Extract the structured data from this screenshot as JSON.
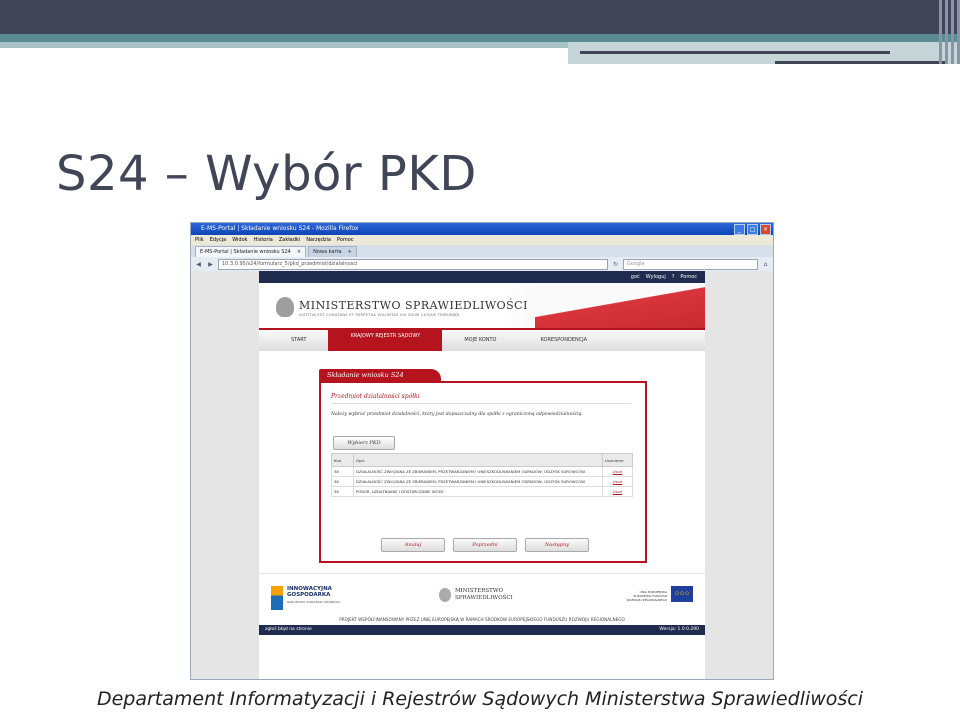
{
  "slide": {
    "title": "S24 – Wybór PKD",
    "footer": "Departament Informatyzacji i Rejestrów Sądowych Ministerstwa Sprawiedliwości"
  },
  "browser": {
    "window_title": "E-MS-Portal | Składanie wniosku S24 - Mozilla Firefox",
    "menu": [
      "Plik",
      "Edycja",
      "Widok",
      "Historia",
      "Zakładki",
      "Narzędzia",
      "Pomoc"
    ],
    "tabs": [
      {
        "label": "E-MS-Portal | Składanie wniosku S24",
        "close": "×"
      },
      {
        "label": "Nowa karta",
        "close": "+"
      }
    ],
    "url": "10.3.0.95/s24/formularz_5/pkd_przedmiot/dzialalnosci",
    "search_placeholder": "Google"
  },
  "portal": {
    "top_links": [
      "goć",
      "Wyloguj",
      "?",
      "Pomoc"
    ],
    "logo_title": "MINISTERSTWO SPRAWIEDLIWOŚCI",
    "logo_motto": "IUSTITIA EST CONSTANS ET PERPETUA VOLUNTAS IUS SUUM CUIQUE TRIBUENDI",
    "nav": [
      "START",
      "KRAJOWY REJESTR SĄDOWY",
      "MOJE KONTO",
      "KORESPONDENCJA"
    ],
    "panel_title": "Składanie wniosku S24",
    "section_title": "Przedmiot działalności spółki",
    "instruction": "Należy wybrać przedmiot działalności, który jest dopuszczalny dla spółki z ograniczoną odpowiedzialnością.",
    "pick_button": "Wybierz PKD",
    "table": {
      "headers": [
        "Kod",
        "Opis",
        "Usunięcie"
      ],
      "rows": [
        {
          "code": "38",
          "desc": "DZIAŁALNOŚĆ ZWIĄZANA ZE ZBIERANIEM, PRZETWARZANIEM I UNIESZKODLIWIANIEM ODPADÓW; ODZYSK SUROWCÓW",
          "action": "Usuń"
        },
        {
          "code": "38",
          "desc": "DZIAŁALNOŚĆ ZWIĄZANA ZE ZBIERANIEM, PRZETWARZANIEM I UNIESZKODLIWIANIEM ODPADÓW; ODZYSK SUROWCÓW",
          "action": "Usuń"
        },
        {
          "code": "36",
          "desc": "POBÓR, UZDATNIANIE I DOSTARCZANIE WODY",
          "action": "Usuń"
        }
      ]
    },
    "buttons": {
      "cancel": "Anuluj",
      "prev": "Poprzedni",
      "next": "Następny"
    },
    "logos": {
      "ig_title_1": "INNOWACYJNA",
      "ig_title_2": "GOSPODARKA",
      "ig_sub": "NARODOWA STRATEGIA SPÓJNOŚCI",
      "ms_1": "MINISTERSTWO",
      "ms_2": "SPRAWIEDLIWOŚCI",
      "ue_1": "UNIA EUROPEJSKA",
      "ue_2": "EUROPEJSKI FUNDUSZ",
      "ue_3": "ROZWOJU REGIONALNEGO"
    },
    "funding_note": "PROJEKT WSPÓŁFINANSOWANY PRZEZ UNIĘ EUROPEJSKĄ W RAMACH ŚRODKÓW EUROPEJSKIEGO FUNDUSZU ROZWOJU REGIONALNEGO",
    "status_left": "zgłoś błąd na stronie",
    "status_right": "Wersja: 1.0.0.290"
  },
  "colors": {
    "accent": "#b5141f",
    "slide_dark": "#414558",
    "slide_teal": "#5a8d92"
  }
}
